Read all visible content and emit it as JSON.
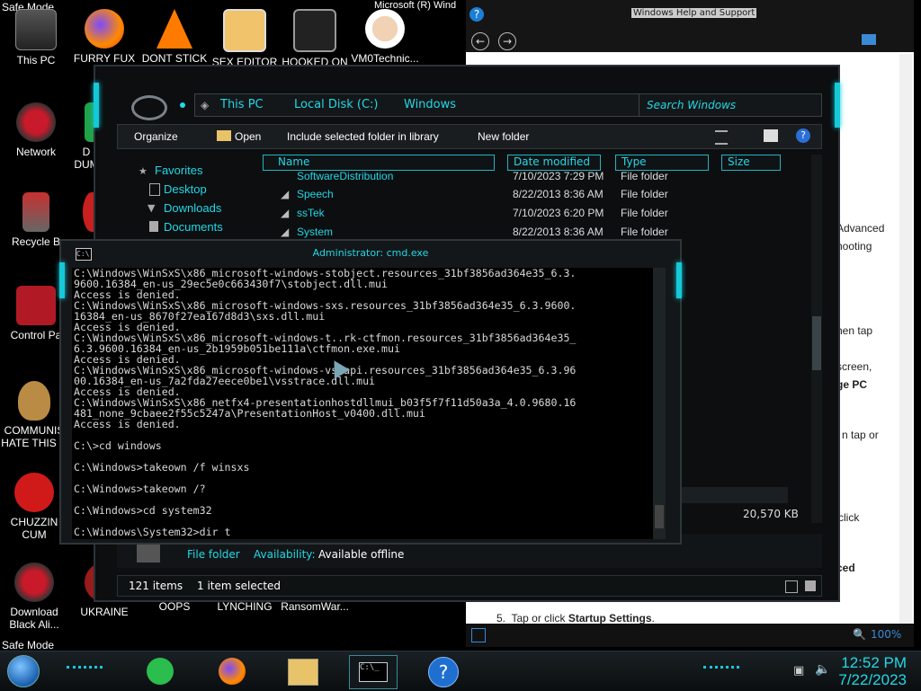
{
  "desktop": {
    "safe_mode_top": "Safe Mode",
    "safe_mode_bottom": "Safe Mode",
    "icons": [
      {
        "label": "This PC"
      },
      {
        "label": "FURRY FUX"
      },
      {
        "label": "DONT STICK"
      },
      {
        "label": "SEX EDITOR"
      },
      {
        "label": "HOOKED ON"
      },
      {
        "label": "VM0Technic..."
      },
      {
        "label": "Network"
      },
      {
        "label": "D"
      },
      {
        "label": "DUM"
      },
      {
        "label": "Recycle B"
      },
      {
        "label": "Control Pa"
      },
      {
        "label": "COMMUNIS"
      },
      {
        "label": "HATE THIS C"
      },
      {
        "label": "CHUZZIN"
      },
      {
        "label": "CUM"
      },
      {
        "label": "Download"
      },
      {
        "label": "Black Ali..."
      },
      {
        "label": "UKRAINE"
      },
      {
        "label": "OOPS"
      },
      {
        "label": "LYNCHING"
      },
      {
        "label": "RansomWar..."
      },
      {
        "label": "Microsoft (R) Wind"
      }
    ]
  },
  "help_window": {
    "title": "Windows Help and Support",
    "snippets": [
      "Advanced",
      "hooting",
      "hen tap",
      "screen,",
      "ge PC",
      "n tap or",
      "click",
      "ced"
    ],
    "step_num": "5.",
    "step_text": "Tap or click",
    "step_bold": "Startup Settings",
    "step_end": ".",
    "zoom": "100%"
  },
  "explorer": {
    "breadcrumb": [
      "This PC",
      "Local Disk (C:)",
      "Windows"
    ],
    "search_placeholder": "Search Windows",
    "toolbar": {
      "organize": "Organize",
      "open": "Open",
      "include": "Include selected folder in library",
      "new_folder": "New folder"
    },
    "nav": {
      "favorites": "Favorites",
      "desktop": "Desktop",
      "downloads": "Downloads",
      "documents": "Documents"
    },
    "columns": [
      "Name",
      "Date modified",
      "Type",
      "Size"
    ],
    "rows": [
      {
        "name": "SoftwareDistribution",
        "date": "7/10/2023 7:29 PM",
        "type": "File folder"
      },
      {
        "name": "Speech",
        "date": "8/22/2013 8:36 AM",
        "type": "File folder"
      },
      {
        "name": "ssTek",
        "date": "7/10/2023 6:20 PM",
        "type": "File folder"
      },
      {
        "name": "System",
        "date": "8/22/2013 8:36 AM",
        "type": "File folder"
      }
    ],
    "size_value": "20,570 KB",
    "details": {
      "type": "File folder",
      "availability_label": "Availability:",
      "availability_value": "Available offline"
    },
    "status": {
      "count": "121 items",
      "selected": "1 item selected"
    }
  },
  "cmd": {
    "title": "Administrator: cmd.exe",
    "lines": "C:\\Windows\\WinSxS\\x86_microsoft-windows-stobject.resources_31bf3856ad364e35_6.3.\n9600.16384_en-us_29ec5e0c663430f7\\stobject.dll.mui\nAccess is denied.\nC:\\Windows\\WinSxS\\x86_microsoft-windows-sxs.resources_31bf3856ad364e35_6.3.9600.\n16384_en-us_8670f27ea167d8d3\\sxs.dll.mui\nAccess is denied.\nC:\\Windows\\WinSxS\\x86_microsoft-windows-t..rk-ctfmon.resources_31bf3856ad364e35_\n6.3.9600.16384_en-us_2b1959b051be111a\\ctfmon.exe.mui\nAccess is denied.\nC:\\Windows\\WinSxS\\x86_microsoft-windows-vssapi.resources_31bf3856ad364e35_6.3.96\n00.16384_en-us_7a2fda27eece0be1\\vsstrace.dll.mui\nAccess is denied.\nC:\\Windows\\WinSxS\\x86_netfx4-presentationhostdllmui_b03f5f7f11d50a3a_4.0.9680.16\n481_none_9cbaee2f55c5247a\\PresentationHost_v0400.dll.mui\nAccess is denied.\n\nC:\\>cd windows\n\nC:\\Windows>takeown /f winsxs\n\nC:\\Windows>takeown /?\n\nC:\\Windows>cd system32\n\nC:\\Windows\\System32>dir t"
  },
  "taskbar": {
    "time": "12:52 PM",
    "date": "7/22/2023"
  },
  "colors": {
    "accent": "#22d8e6",
    "window_bg": "#0c0e10",
    "console_bg": "#000000"
  }
}
